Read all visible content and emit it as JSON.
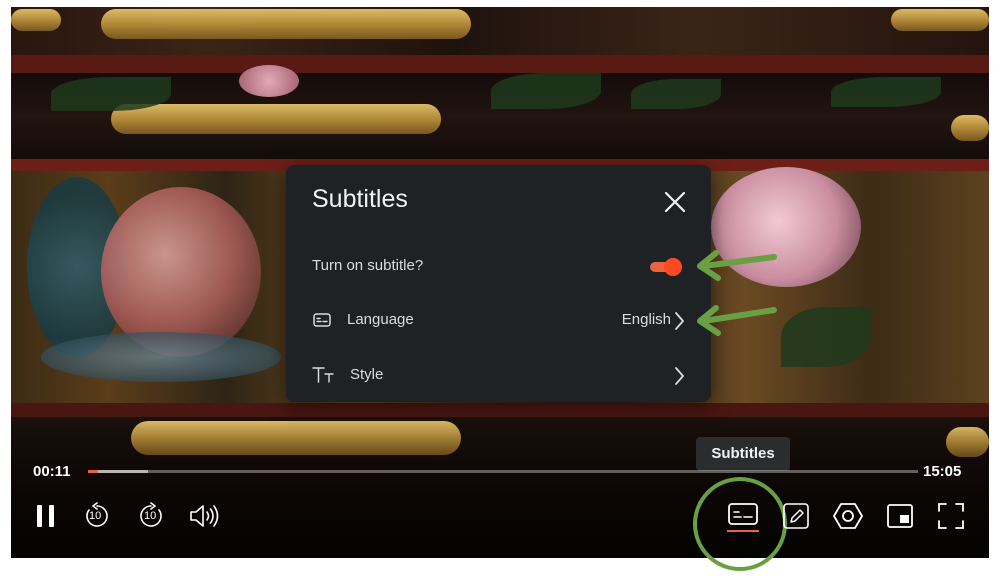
{
  "panel": {
    "title": "Subtitles",
    "toggle_label": "Turn on subtitle?",
    "toggle_on": true,
    "language_label": "Language",
    "language_value": "English",
    "style_label": "Style"
  },
  "player": {
    "current_time": "00:11",
    "duration": "15:05",
    "progress_fraction": 0.012,
    "tooltip": "Subtitles",
    "rewind_seconds": "10",
    "forward_seconds": "10"
  },
  "colors": {
    "accent": "#e8643e",
    "annotation": "#6aa043",
    "panel_bg": "#1f2224"
  },
  "icons": {
    "close": "close-icon",
    "subtitle": "subtitle-icon",
    "text_style": "text-style-icon",
    "chevron": "chevron-right-icon",
    "pause": "pause-icon",
    "rewind": "rewind-10-icon",
    "forward": "forward-10-icon",
    "volume": "volume-icon",
    "pen": "pen-icon",
    "settings": "settings-icon",
    "pip": "picture-in-picture-icon",
    "fullscreen": "fullscreen-icon"
  }
}
